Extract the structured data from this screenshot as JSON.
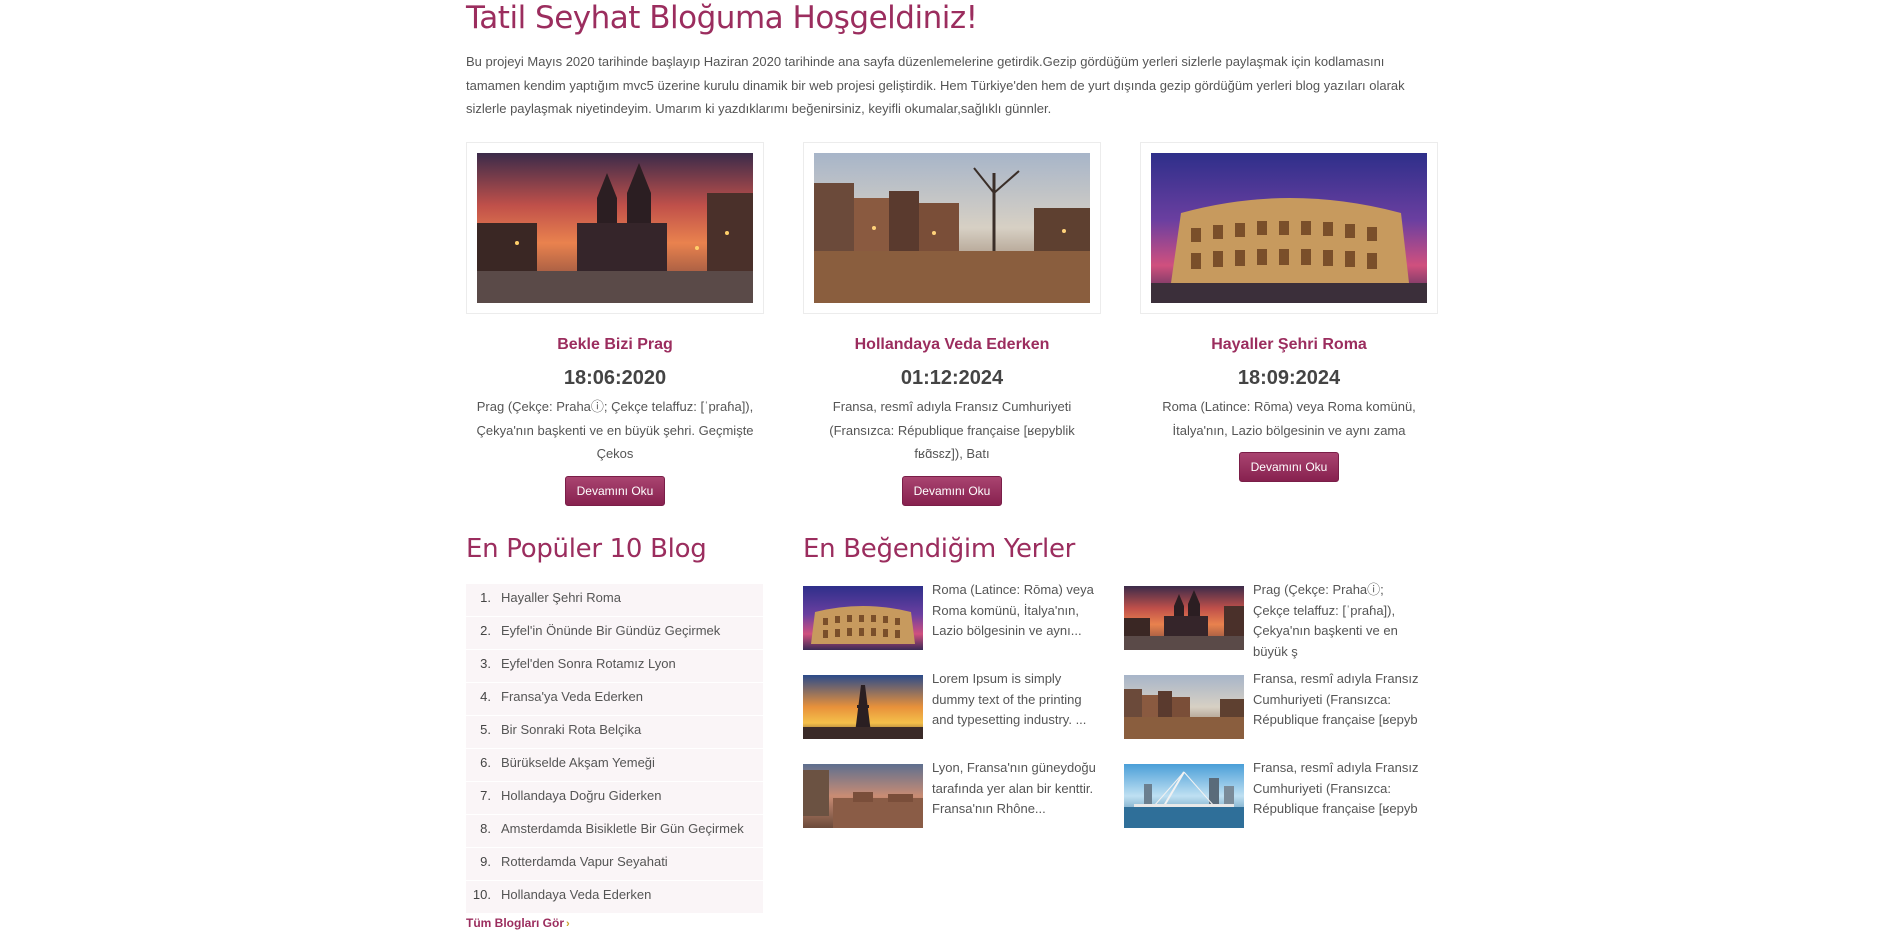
{
  "header": {
    "title": "Tatil Seyhat Bloğuma Hoşgeldiniz!",
    "intro": "Bu projeyi Mayıs 2020 tarihinde başlayıp Haziran 2020 tarihinde ana sayfa düzenlemelerine getirdik.Gezip gördüğüm yerleri sizlerle paylaşmak için kodlamasını tamamen kendim yaptığım mvc5 üzerine kurulu dinamik bir web projesi geliştirdik. Hem Türkiye'den hem de yurt dışında gezip gördüğüm yerleri blog yazıları olarak sizlerle paylaşmak niyetindeyim. Umarım ki yazdıklarımı beğenirsiniz, keyifli okumalar,sağlıklı günnler."
  },
  "featured": [
    {
      "title": "Bekle Bizi Prag",
      "date": "18:06:2020",
      "excerpt": "Prag (Çekçe: Prahaⓘ; Çekçe telaffuz: [ˈpraɦa]), Çekya'nın başkenti ve en büyük şehri. Geçmişte Çekos",
      "button": "Devamını Oku",
      "image": "prague-photo"
    },
    {
      "title": "Hollandaya Veda Ederken",
      "date": "01:12:2024",
      "excerpt": "Fransa, resmî adıyla Fransız Cumhuriyeti (Fransızca: République française [ʁepyblik fʁɑ̃sɛz]), Batı",
      "button": "Devamını Oku",
      "image": "amsterdam-photo"
    },
    {
      "title": "Hayaller Şehri Roma",
      "date": "18:09:2024",
      "excerpt": "Roma (Latince: Rōma) veya Roma komünü, İtalya'nın, Lazio bölgesinin ve aynı zama",
      "button": "Devamını Oku",
      "image": "colosseum-photo"
    }
  ],
  "popular": {
    "title": "En Popüler 10 Blog",
    "items": [
      {
        "num": "1.",
        "label": "Hayaller Şehri Roma"
      },
      {
        "num": "2.",
        "label": "Eyfel'in Önünde Bir Gündüz Geçirmek"
      },
      {
        "num": "3.",
        "label": "Eyfel'den Sonra Rotamız Lyon"
      },
      {
        "num": "4.",
        "label": "Fransa'ya Veda Ederken"
      },
      {
        "num": "5.",
        "label": "Bir Sonraki Rota Belçika"
      },
      {
        "num": "6.",
        "label": "Bürükselde Akşam Yemeği"
      },
      {
        "num": "7.",
        "label": "Hollandaya Doğru Giderken"
      },
      {
        "num": "8.",
        "label": "Amsterdamda Bisikletle Bir Gün Geçirmek"
      },
      {
        "num": "9.",
        "label": "Rotterdamda Vapur Seyahati"
      },
      {
        "num": "10.",
        "label": "Hollandaya Veda Ederken"
      }
    ],
    "all_link": "Tüm Blogları Gör",
    "all_chevron": "›"
  },
  "favorites": {
    "title": "En Beğendiğim Yerler",
    "items": [
      {
        "text": "Roma (Latince: Rōma) veya Roma komünü, İtalya'nın, Lazio bölgesinin ve aynı...",
        "image": "colosseum-thumb"
      },
      {
        "text": "Prag (Çekçe: Prahaⓘ; Çekçe telaffuz: [ˈpraɦa]), Çekya'nın başkenti ve en büyük ş",
        "image": "prague-thumb"
      },
      {
        "text": "Lorem Ipsum is simply dummy text of the printing and typesetting industry. ...",
        "image": "eiffel-thumb"
      },
      {
        "text": "Fransa, resmî adıyla Fransız Cumhuriyeti (Fransızca: République française [ʁepyb",
        "image": "amsterdam-thumb"
      },
      {
        "text": "Lyon, Fransa'nın güneydoğu tarafında yer alan bir kenttir. Fransa'nın Rhône...",
        "image": "lyon-thumb"
      },
      {
        "text": "Fransa, resmî adıyla Fransız Cumhuriyeti (Fransızca: République française [ʁepyb",
        "image": "rotterdam-thumb"
      }
    ]
  },
  "colors": {
    "accent": "#9b2d5e",
    "button": "#8e2a56",
    "list_bg": "#faf5f7"
  }
}
